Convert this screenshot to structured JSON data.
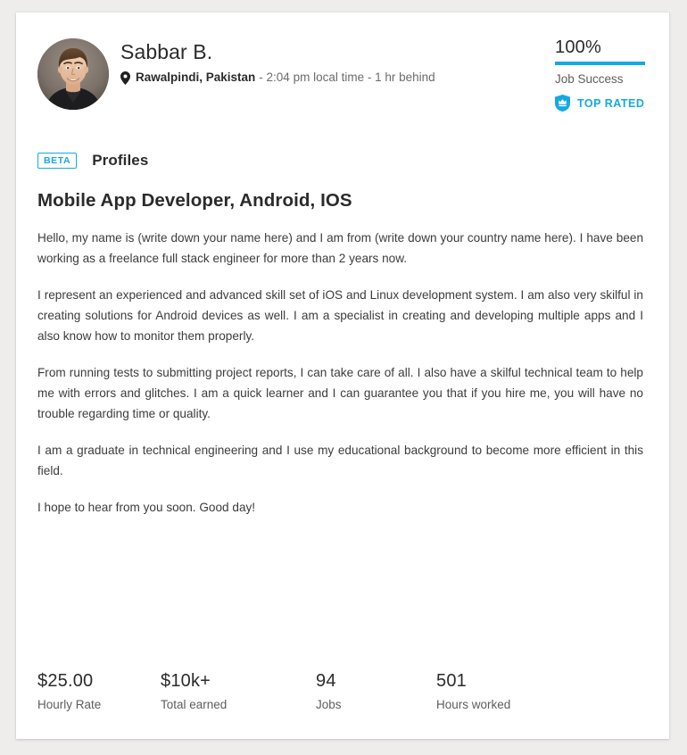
{
  "colors": {
    "accent": "#14a9e1",
    "page_background": "#eeedec",
    "card_background": "#ffffff",
    "text_primary": "#2b2b2b",
    "text_secondary": "#5d5d5d"
  },
  "header": {
    "avatar_alt": "avatar-photo",
    "name": "Sabbar B.",
    "location_icon": "map-pin-icon",
    "location": "Rawalpindi, Pakistan",
    "time": "- 2:04 pm local time - 1 hr behind",
    "job_success": {
      "percent": "100%",
      "label": "Job Success",
      "bar_fill_percent": 100
    },
    "badge": {
      "icon": "shield-crown-icon",
      "label": "TOP RATED"
    }
  },
  "section": {
    "beta_label": "BETA",
    "title": "Profiles"
  },
  "profile": {
    "title": "Mobile App Developer, Android, IOS",
    "paragraphs": [
      "Hello, my name is (write down your name here) and I am from (write down your country name here).  I have been working as a freelance full stack engineer for more than 2 years now.",
      "I represent an experienced and advanced skill set of iOS and Linux development system. I am also very skilful in creating solutions for Android devices as well. I am a specialist in creating and developing multiple apps and I also know how to monitor them properly.",
      "From running tests to submitting project reports, I can take care of all. I also have a skilful technical team to help me with errors and glitches. I am a quick learner and I can guarantee you that if you hire me, you will have no trouble regarding time or quality.",
      "I am a graduate in technical engineering and I use my educational background to become more efficient in this field.",
      "I hope to hear from you soon. Good day!"
    ]
  },
  "stats": [
    {
      "value": "$25.00",
      "label": "Hourly Rate"
    },
    {
      "value": "$10k+",
      "label": "Total earned"
    },
    {
      "value": "94",
      "label": "Jobs"
    },
    {
      "value": "501",
      "label": "Hours worked"
    }
  ]
}
